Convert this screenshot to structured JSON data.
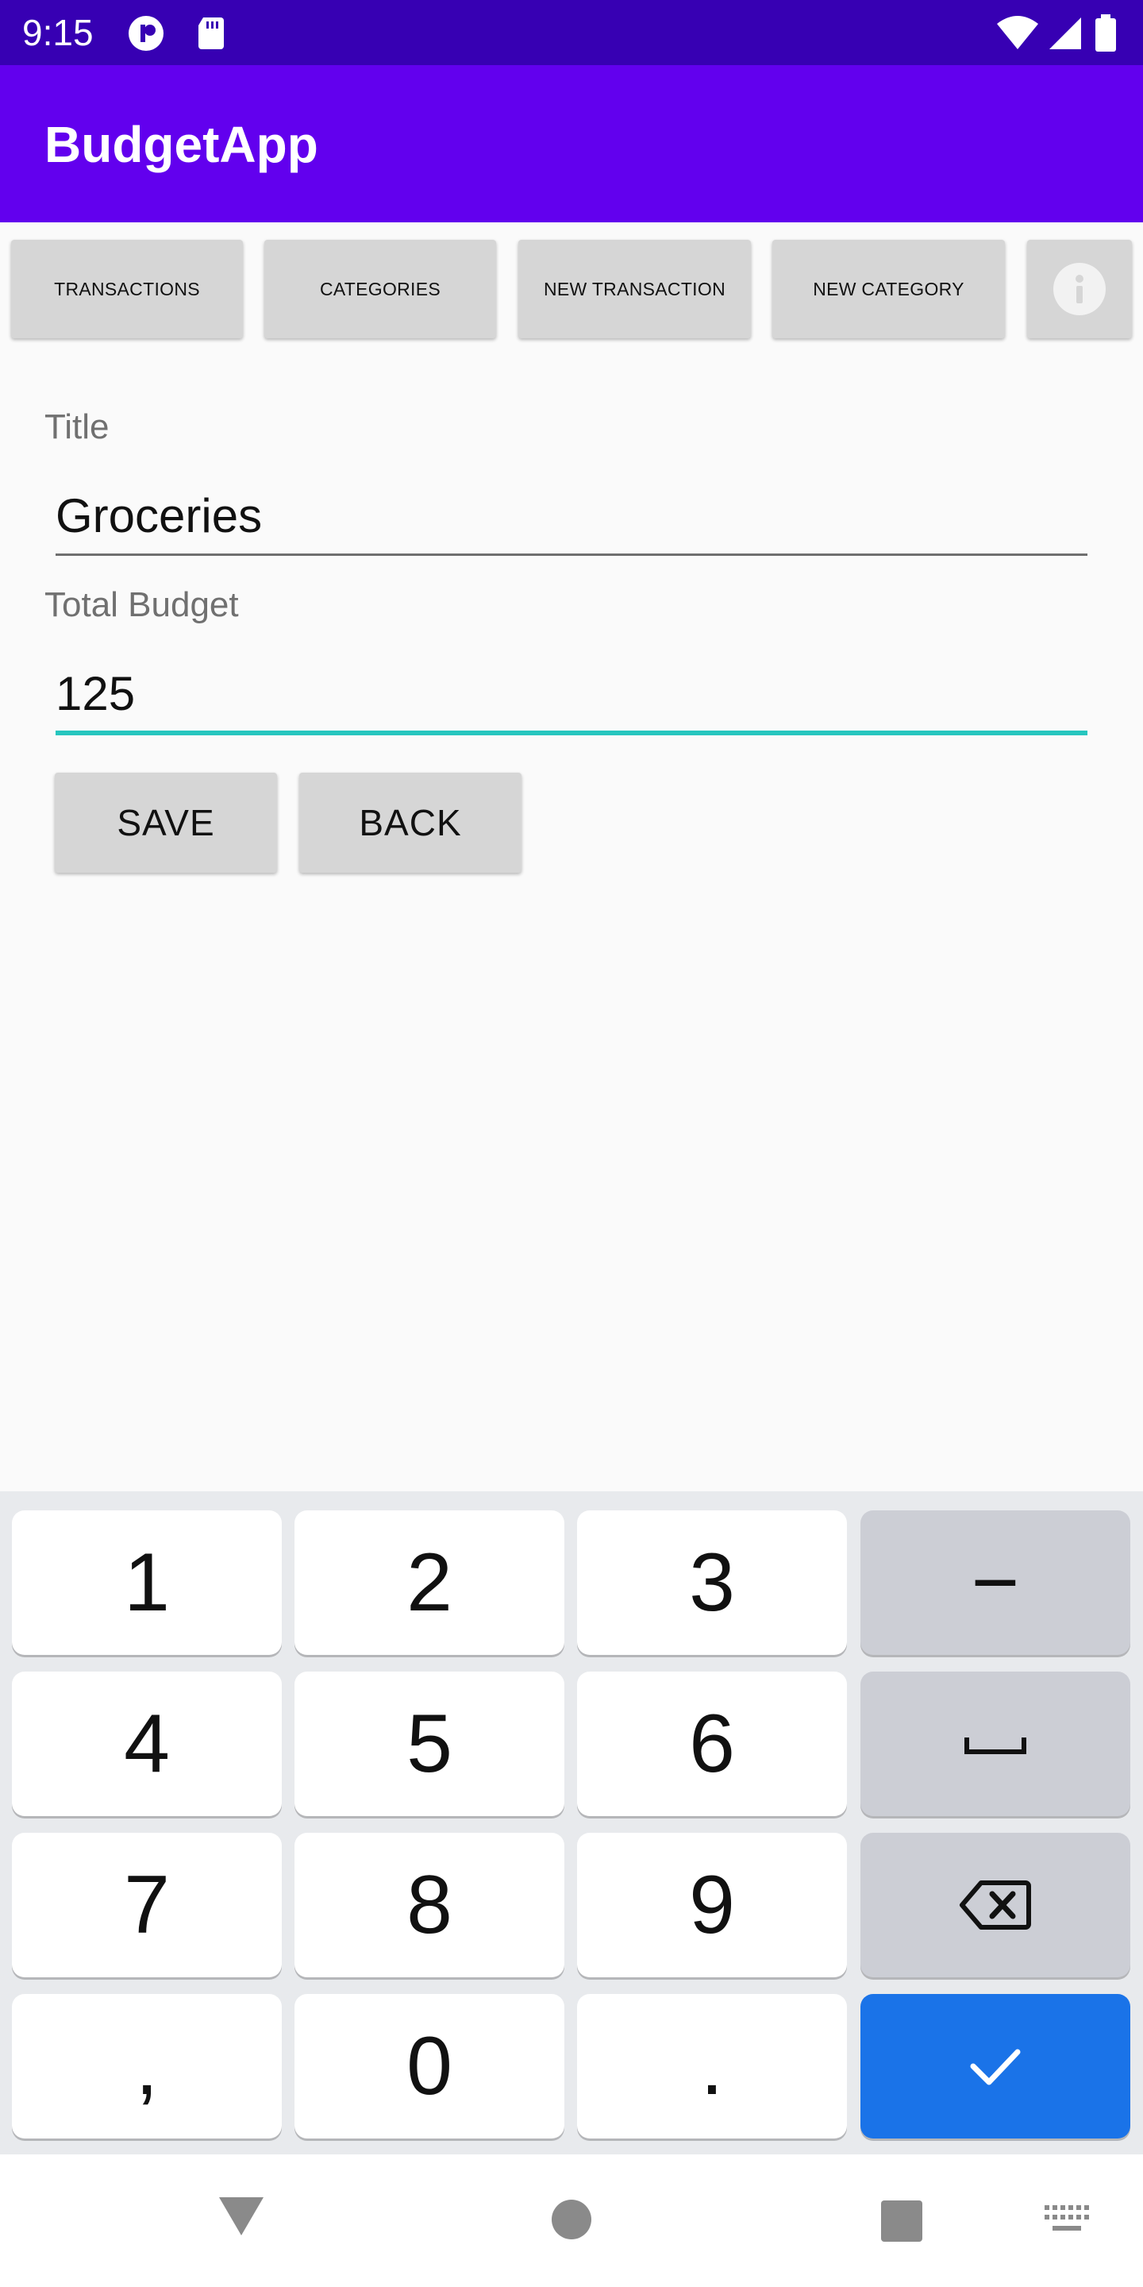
{
  "status_bar": {
    "time": "9:15",
    "icons": [
      "app-notification-icon",
      "sd-card-icon",
      "wifi-icon",
      "cell-signal-icon",
      "battery-icon"
    ]
  },
  "app_bar": {
    "title": "BudgetApp"
  },
  "nav": {
    "transactions": "TRANSACTIONS",
    "categories": "CATEGORIES",
    "new_transaction": "NEW TRANSACTION",
    "new_category": "NEW CATEGORY",
    "info_icon": "info-icon"
  },
  "form": {
    "title_label": "Title",
    "title_value": "Groceries",
    "budget_label": "Total Budget",
    "budget_value": "125",
    "save": "SAVE",
    "back": "BACK"
  },
  "keyboard": {
    "rows": [
      [
        "1",
        "2",
        "3",
        "−"
      ],
      [
        "4",
        "5",
        "6",
        "space"
      ],
      [
        "7",
        "8",
        "9",
        "backspace"
      ],
      [
        ",",
        "0",
        ".",
        "done"
      ]
    ],
    "k1": "1",
    "k2": "2",
    "k3": "3",
    "minus": "−",
    "k4": "4",
    "k5": "5",
    "k6": "6",
    "k7": "7",
    "k8": "8",
    "k9": "9",
    "comma": ",",
    "k0": "0",
    "period": "."
  },
  "colors": {
    "status_bar": "#3700b3",
    "app_bar": "#6200ee",
    "active_underline": "#26c6bf",
    "done_key": "#1a73e8"
  }
}
